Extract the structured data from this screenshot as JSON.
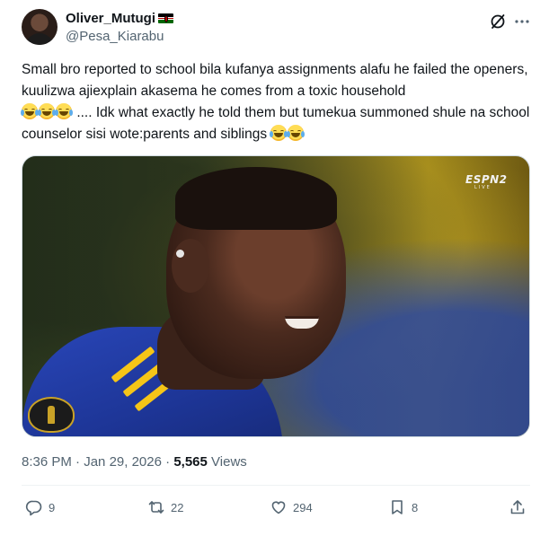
{
  "author": {
    "display_name": "Oliver_Mutugi",
    "handle": "@Pesa_Kiarabu"
  },
  "tweet": {
    "line1": "Small bro reported to school bila kufanya assignments alafu he failed the openers, kuulizwa ajiexplain akasema he comes from a toxic household",
    "line2": ".... Idk what exactly he told them but tumekua summoned shule na school counselor sisi wote:parents and siblings"
  },
  "media": {
    "broadcaster": "ESPN2",
    "broadcaster_sub": "LIVE"
  },
  "meta": {
    "time": "8:36 PM",
    "separator1": "·",
    "date": "Jan 29, 2026",
    "separator2": "·",
    "views_count": "5,565",
    "views_label": "Views"
  },
  "actions": {
    "replies": "9",
    "reposts": "22",
    "likes": "294",
    "bookmarks": "8"
  },
  "icons": [
    "grok-icon",
    "more-icon",
    "reply-icon",
    "repost-icon",
    "like-icon",
    "bookmark-icon",
    "share-icon"
  ]
}
